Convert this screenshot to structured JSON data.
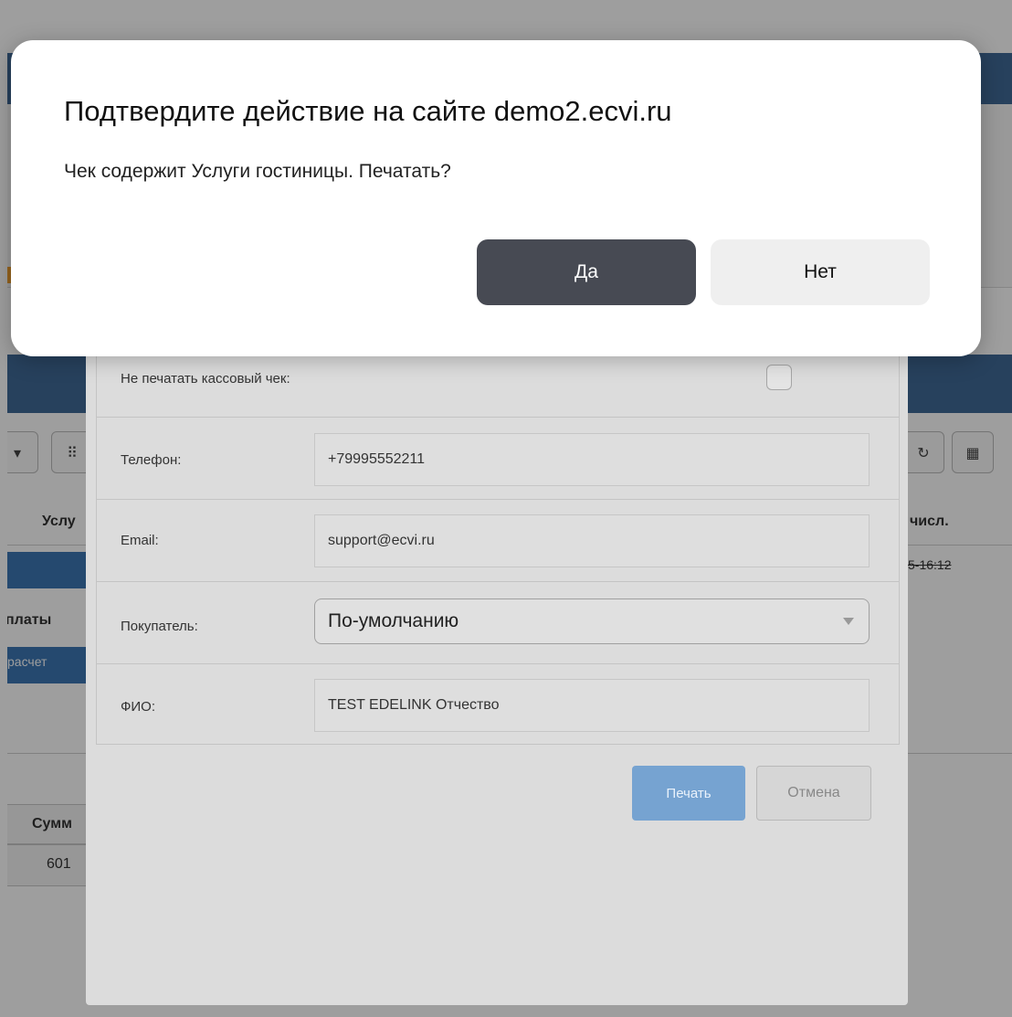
{
  "confirm_dialog": {
    "title": "Подтвердите действие на сайте demo2.ecvi.ru",
    "message": "Чек содержит Услуги гостиницы. Печатать?",
    "yes_label": "Да",
    "no_label": "Нет",
    "yes_color": "#474a53"
  },
  "print_dialog": {
    "no_print_label": "Не печатать кассовый чек:",
    "no_print_checked": false,
    "phone_label": "Телефон:",
    "phone_value": "+79995552211",
    "email_label": "Email:",
    "email_value": "support@ecvi.ru",
    "buyer_label": "Покупатель:",
    "buyer_value": "По-умолчанию",
    "fio_label": "ФИО:",
    "fio_value": "TEST EDELINK Отчество",
    "print_label": "Печать",
    "cancel_label": "Отмена",
    "print_button_color": "#76a3d1"
  },
  "background_page": {
    "services_header_fragment": "Услу",
    "payment_header_fragment": "платы",
    "payment_cell_fragment": "расчет",
    "enroll_header_fragment": "числ.",
    "enroll_date_fragment": "5-16:12",
    "sum_header_fragment": "Сумм",
    "sum_value_fragment": "601",
    "toolbar_icons": [
      "chevron-icon",
      "grid-icon",
      "refresh-icon",
      "qr-code-icon"
    ],
    "accent_color": "#3d76b4"
  }
}
